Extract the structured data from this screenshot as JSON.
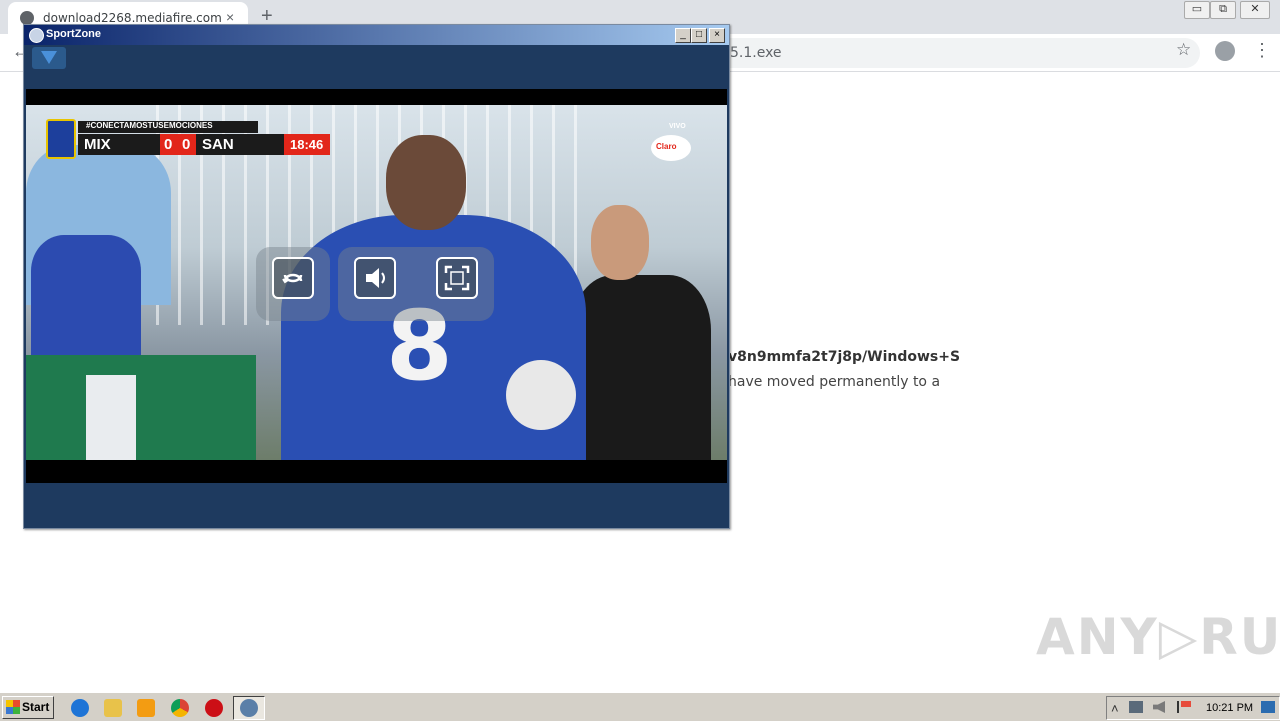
{
  "browser": {
    "tab_title": "download2268.mediafire.com",
    "tab_close": "×",
    "new_tab": "+",
    "window_min": "▭",
    "window_restore": "⧉",
    "window_close": "✕",
    "back": "←",
    "url_visible": "5.1.exe",
    "star": "☆",
    "menu": "⋮"
  },
  "page": {
    "text_line1": "v8n9mmfa2t7j8p/Windows+S",
    "text_line2": "have moved permanently to a"
  },
  "watermark": "ANY▷RUN",
  "sportzone": {
    "title": "SportZone",
    "controls": {
      "minimize": "_",
      "maximize": "□",
      "close": "×"
    },
    "scoreboard": {
      "tag": "#CONECTAMOSTUSEMOCIONES",
      "team1": "MIX",
      "score1": "0",
      "score2": "0",
      "team2": "SAN",
      "time": "18:46"
    },
    "broadcast": {
      "logo": "Claro",
      "badge": "VIVO"
    },
    "jersey_number": "8"
  },
  "taskbar": {
    "start_label": "Start",
    "clock": "10:21 PM",
    "tray_up": "˄"
  }
}
